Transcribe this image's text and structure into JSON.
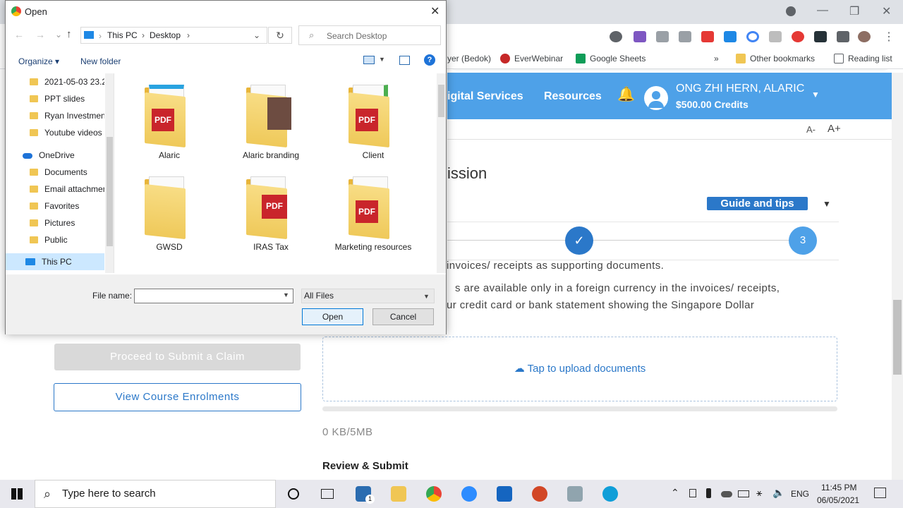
{
  "browser": {
    "bookmarks": [
      "yer (Bedok)",
      "EverWebinar",
      "Google Sheets",
      "»",
      "Other bookmarks",
      "Reading list"
    ],
    "window_controls": [
      "—",
      "❐",
      "✕"
    ]
  },
  "site": {
    "nav": [
      "igital Services",
      "Resources"
    ],
    "user_name": "ONG ZHI HERN, ALARIC",
    "credits": "$500.00 Credits",
    "font_small": "A-",
    "font_large": "A+",
    "section_title": "ission",
    "guide_label": "Guide and tips",
    "step_number": "3",
    "instructions": [
      "invoices/ receipts as supporting documents.",
      "s are available only in a foreign currency in the invoices/ receipts,",
      "ur credit card or bank statement showing the Singapore Dollar"
    ],
    "proceed_button": "Proceed to Submit a Claim",
    "view_enrolments_button": "View Course Enrolments",
    "upload_label": "Tap to upload documents",
    "size_label": "0 KB/5MB",
    "review_title": "Review & Submit"
  },
  "dialog": {
    "title": "Open",
    "breadcrumb": [
      "This PC",
      "Desktop"
    ],
    "search_placeholder": "Search Desktop",
    "organize": "Organize ▾",
    "new_folder": "New folder",
    "nav_items": [
      "2021-05-03 23.2",
      "PPT slides",
      "Ryan Investment",
      "Youtube videos",
      "OneDrive",
      "Documents",
      "Email attachmen",
      "Favorites",
      "Pictures",
      "Public",
      "This PC"
    ],
    "files": [
      {
        "name": "Alaric",
        "pdf": true
      },
      {
        "name": "Alaric branding",
        "pdf": false
      },
      {
        "name": "Client",
        "pdf": true
      },
      {
        "name": "GWSD",
        "pdf": false
      },
      {
        "name": "IRAS Tax",
        "pdf": true
      },
      {
        "name": "Marketing resources",
        "pdf": true
      }
    ],
    "filename_label": "File name:",
    "filename_value": "",
    "filetype": "All Files",
    "open_button": "Open",
    "cancel_button": "Cancel",
    "pdf_text": "PDF"
  },
  "taskbar": {
    "search_placeholder": "Type here to search",
    "language": "ENG",
    "time": "11:45 PM",
    "date": "06/05/2021",
    "mail_badge": "1"
  }
}
